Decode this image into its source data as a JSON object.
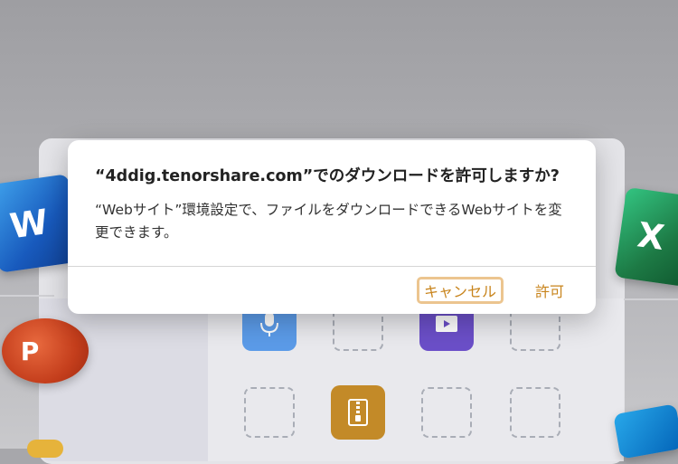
{
  "dialog": {
    "title": "“4ddig.tenorshare.com”でのダウンロードを許可しますか?",
    "message": "“Webサイト”環境設定で、ファイルをダウンロードできるWebサイトを変更できます。",
    "cancel_label": "キャンセル",
    "allow_label": "許可"
  },
  "background": {
    "apps": {
      "word_letter": "W",
      "powerpoint_letter": "P",
      "excel_letter": "X"
    },
    "icons": [
      "microphone-icon",
      "video-icon",
      "zip-archive-icon"
    ]
  },
  "colors": {
    "accent": "#c8841c",
    "cancel_border": "#ecc58f",
    "word": "#2b579a",
    "excel": "#1d7a45",
    "powerpoint": "#c43e1c",
    "mic_tile": "#5b9be8",
    "video_tile": "#6b4fc8",
    "zip_tile": "#c38a28"
  }
}
